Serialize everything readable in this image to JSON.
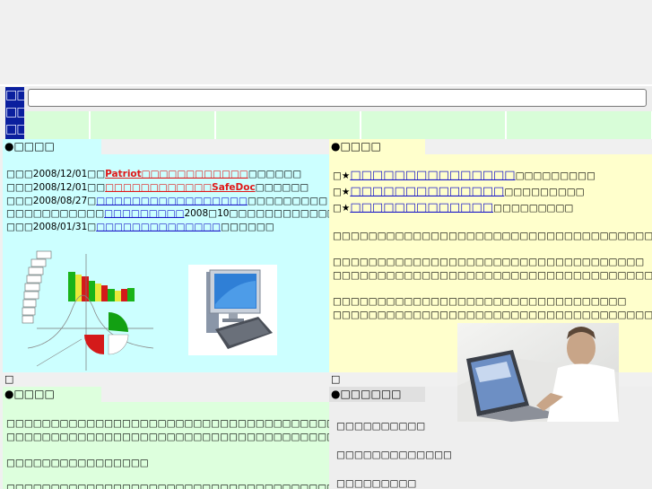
{
  "logo": {
    "glyphs": [
      "□□",
      "□□",
      "□□"
    ]
  },
  "search": {
    "value": "",
    "placeholder": ""
  },
  "nav": {
    "tabs": [
      {
        "label": ""
      },
      {
        "label": "□□□□□□"
      },
      {
        "label": "□□□□□□"
      },
      {
        "label": "□□□□□□"
      },
      {
        "label": "□□□□□□"
      }
    ]
  },
  "news": {
    "heading": "●□□□□",
    "items": [
      {
        "prefix": "□□□2008/12/01□□",
        "link": "Patriot□□□□□□□□□□□□",
        "suffix": "□□□□□□",
        "red": true
      },
      {
        "prefix": "□□□2008/12/01□□",
        "link": "□□□□□□□□□□□□SafeDoc",
        "suffix": "□□□□□□",
        "red": true
      },
      {
        "prefix": "□□□2008/08/27□",
        "link": "□□□□□□□□□□□□□□□□□",
        "suffix": "□□□□□□□□□",
        "red": false
      },
      {
        "prefix": "□□□□□□□□□□□",
        "link": "□□□□□□□□□",
        "suffix": "2008□10□□□□□□□□□□□□",
        "red": false
      },
      {
        "prefix": "□□□2008/01/31□",
        "link": "□□□□□□□□□□□□□□",
        "suffix": "□□□□□□",
        "red": false
      }
    ],
    "bottom_glyph": "□"
  },
  "service": {
    "heading": "●□□□□",
    "star_items": [
      {
        "prefix": "□★",
        "link": "□□□□□□□□□□□□□□□",
        "suffix": "□□□□□□□□□"
      },
      {
        "prefix": "□★",
        "link": "□□□□□□□□□□□□□□",
        "suffix": "□□□□□□□□□"
      },
      {
        "prefix": "□★",
        "link": "□□□□□□□□□□□□□",
        "suffix": "□□□□□□□□□"
      }
    ],
    "paragraphs": [
      "□□□□□□□□□□□□□□□□□□□□□□□□□□□□□□□□□□□□□□□□□□□",
      "□□□□□□□□□□□□□□□□□□□□□□□□□□□□□□□□□□□",
      "□□□□□□□□□□□□□□□□□□□□□□□□□□□□□□□□□□□□□□□□□□□□□□",
      "□□□□□□□□□□□□□□□□□□□□□□□□□□□□□□□□□",
      "□□□□□□□□□□□□□□□□□□□□□□□□□□□□□□□□□□□□□□□□□□□□□□□□"
    ],
    "bottom_glyph": "□"
  },
  "company": {
    "heading": "●□□□□",
    "lines": [
      "□□□□□□□□□□□□□□□□□□□□□□□□□□□□□□□□□□□□□□□□□",
      "□□□□□□□□□□□□□□□□□□□□□□□□□□□□□□□□□□□□□□□□□□□□",
      "□□□□□□□□□□□□□□□□",
      "□□□□□□□□□□□□□□□□□□□□□□□□□□□□□□□□□□□□□"
    ]
  },
  "inquiry": {
    "heading": "●□□□□□□",
    "links": [
      "□□□□□□□□□□",
      "□□□□□□□□□□□□□",
      "□□□□□□□□□"
    ]
  },
  "colors": {
    "logo_bg": "#0a1f9e",
    "nav_tab": "#d8fdd8",
    "news_bg": "#ccffff",
    "service_bg": "#ffffcc",
    "company_bg": "#ddffdd",
    "inquiry_bg": "#eeeeee",
    "link": "#1a18c8",
    "accent_red": "#e01818"
  }
}
